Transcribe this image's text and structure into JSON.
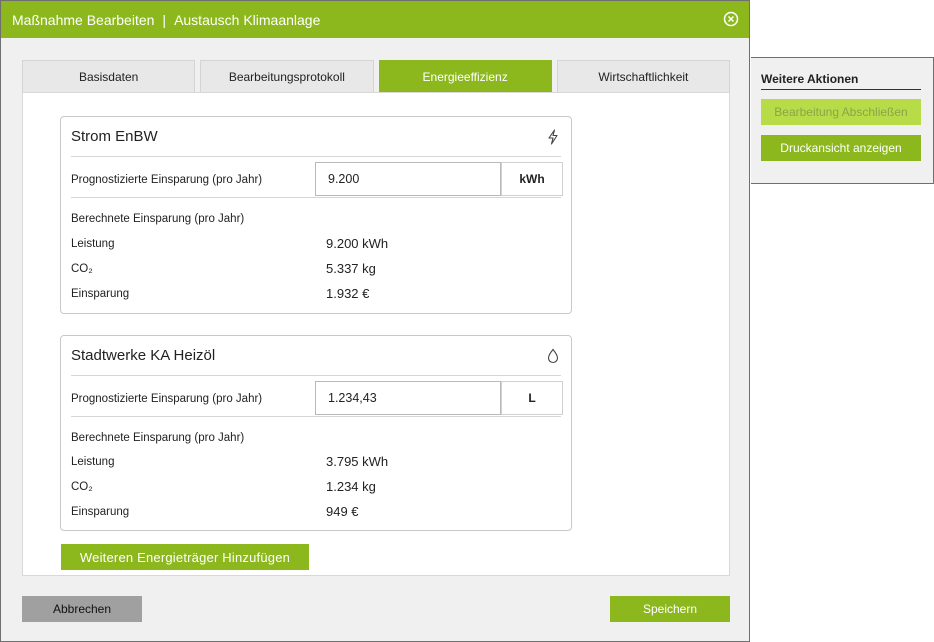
{
  "dialog": {
    "title_action": "Maßnahme Bearbeiten",
    "title_separator": "|",
    "title_subject": "Austausch Klimaanlage"
  },
  "tabs": [
    {
      "label": "Basisdaten",
      "active": false
    },
    {
      "label": "Bearbeitungsprotokoll",
      "active": false
    },
    {
      "label": "Energieeffizienz",
      "active": true
    },
    {
      "label": "Wirtschaftlichkeit",
      "active": false
    }
  ],
  "cards": [
    {
      "title": "Strom EnBW",
      "icon": "lightning-icon",
      "input_label": "Prognostizierte Einsparung (pro Jahr)",
      "input_value": "9.200",
      "unit": "kWh",
      "calc_title": "Berechnete Einsparung (pro Jahr)",
      "rows": [
        {
          "label": "Leistung",
          "value": "9.200 kWh"
        },
        {
          "label": "CO₂",
          "value": "5.337 kg"
        },
        {
          "label": "Einsparung",
          "value": "1.932 €"
        }
      ]
    },
    {
      "title": "Stadtwerke KA Heizöl",
      "icon": "drop-icon",
      "input_label": "Prognostizierte Einsparung (pro Jahr)",
      "input_value": "1.234,43",
      "unit": "L",
      "calc_title": "Berechnete Einsparung (pro Jahr)",
      "rows": [
        {
          "label": "Leistung",
          "value": "3.795 kWh"
        },
        {
          "label": "CO₂",
          "value": "1.234 kg"
        },
        {
          "label": "Einsparung",
          "value": "949 €"
        }
      ]
    }
  ],
  "add_button": "Weiteren Energieträger Hinzufügen",
  "footer": {
    "cancel": "Abbrechen",
    "save": "Speichern"
  },
  "side_panel": {
    "title": "Weitere Aktionen",
    "finish_button": "Bearbeitung Abschließen",
    "print_button": "Druckansicht anzeigen"
  },
  "colors": {
    "accent": "#8cb81d",
    "accent_disabled": "#b8dc48",
    "cancel": "#a0a0a0"
  }
}
